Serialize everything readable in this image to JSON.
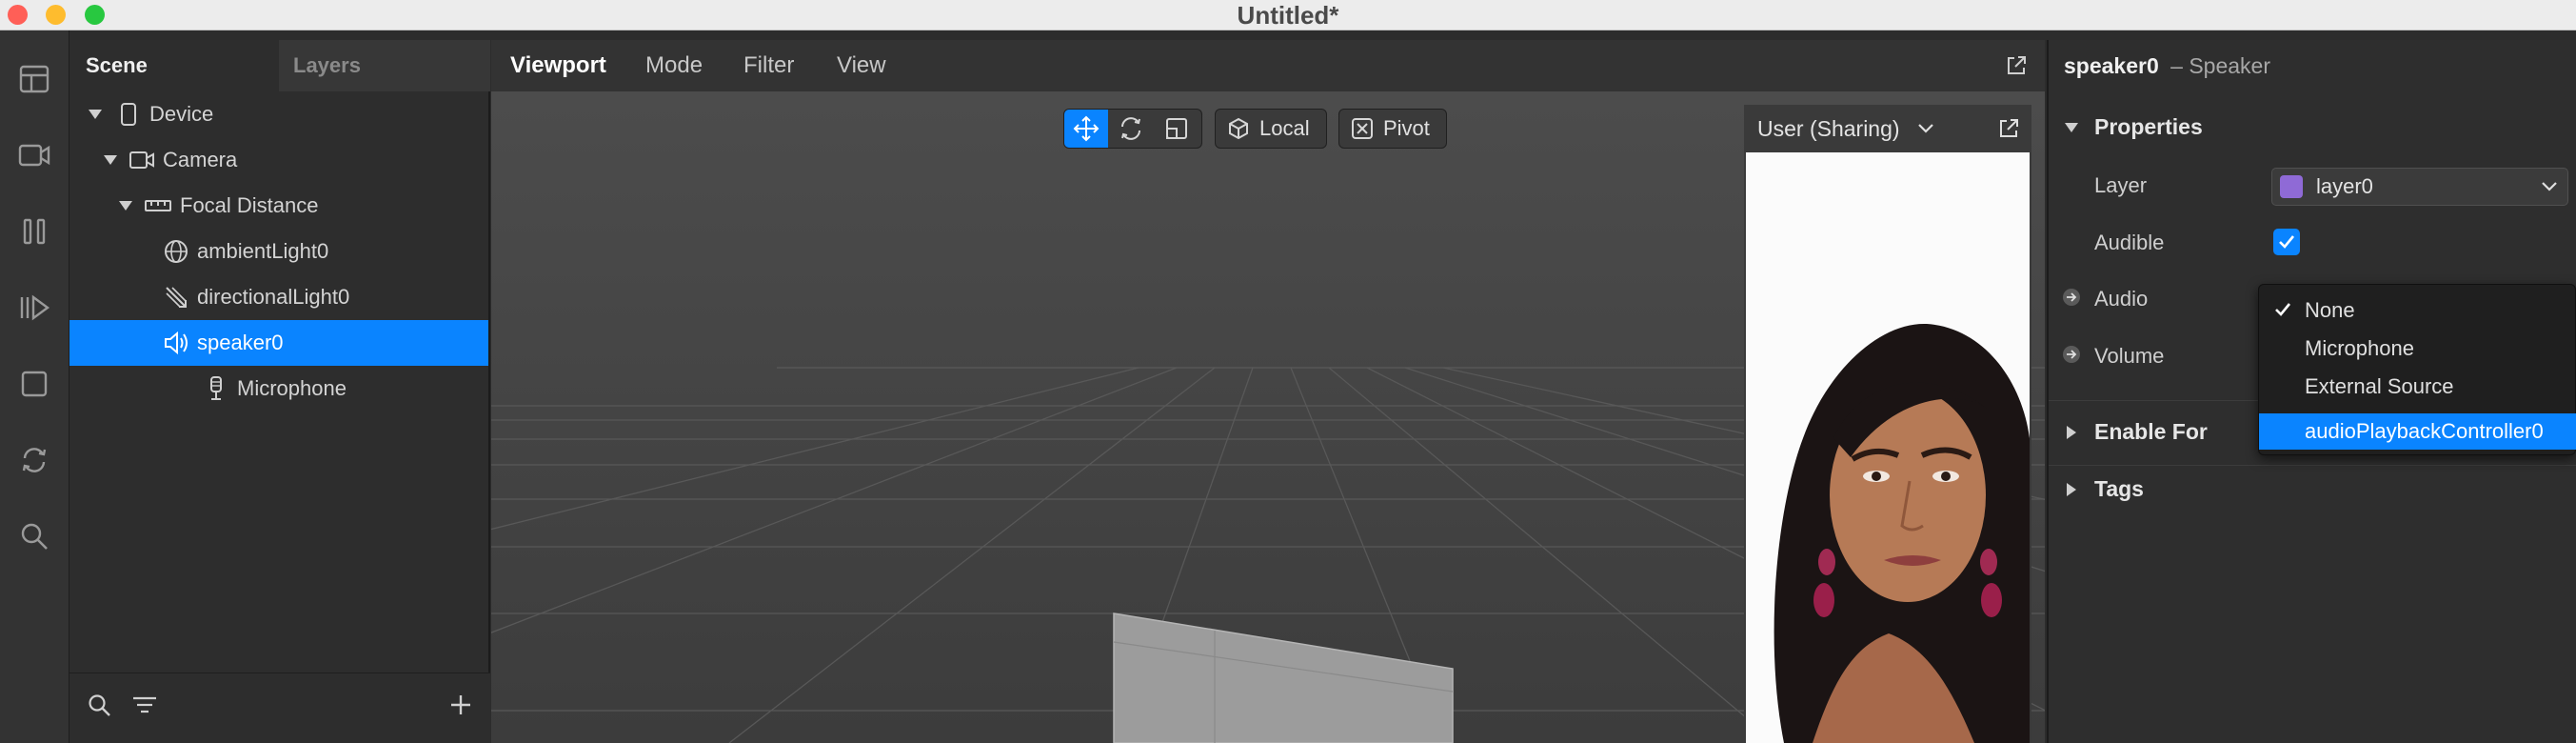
{
  "window": {
    "title": "Untitled*"
  },
  "colors": {
    "accent": "#0a84ff",
    "close": "#ff5f57",
    "minimize": "#febc2e",
    "zoom": "#28c840",
    "layer_swatch": "#8f6ad6"
  },
  "activity_bar": {
    "icons": [
      "layout-icon",
      "video-icon",
      "pause-icon",
      "play-step-icon",
      "square-icon",
      "sync-icon",
      "search-icon"
    ]
  },
  "scene_panel": {
    "tabs": {
      "scene": "Scene",
      "layers": "Layers"
    },
    "tree": [
      {
        "label": "Device",
        "icon": "device-icon"
      },
      {
        "label": "Camera",
        "icon": "camera-icon"
      },
      {
        "label": "Focal Distance",
        "icon": "focal-distance-icon"
      },
      {
        "label": "ambientLight0",
        "icon": "globe-icon"
      },
      {
        "label": "directionalLight0",
        "icon": "directional-light-icon"
      },
      {
        "label": "speaker0",
        "icon": "speaker-icon"
      },
      {
        "label": "Microphone",
        "icon": "microphone-icon"
      }
    ]
  },
  "viewport": {
    "menu": {
      "viewport": "Viewport",
      "mode": "Mode",
      "filter": "Filter",
      "view": "View"
    },
    "toolbar": {
      "local": "Local",
      "pivot": "Pivot"
    },
    "preview": {
      "camera": "User (Sharing)"
    }
  },
  "inspector": {
    "object_name": "speaker0",
    "object_type": "– Speaker",
    "properties_header": "Properties",
    "layer_label": "Layer",
    "layer_value": "layer0",
    "audible_label": "Audible",
    "audio_label": "Audio",
    "volume_label": "Volume",
    "enable_for": "Enable For",
    "tags": "Tags"
  },
  "audio_dropdown": {
    "options": [
      "None",
      "Microphone",
      "External Source",
      "audioPlaybackController0"
    ],
    "checked": "None",
    "highlighted": "audioPlaybackController0"
  }
}
